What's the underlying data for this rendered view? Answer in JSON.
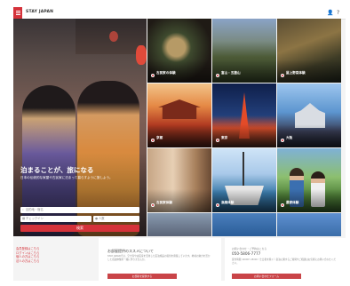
{
  "header": {
    "logo": "STAY JAPAN",
    "person_icon": "person-icon",
    "help_icon": "help-icon",
    "person_glyph": "👤",
    "help_glyph": "?"
  },
  "hero": {
    "title": "泊まることが、旅になる",
    "subtitle": "日本の伝統的な家屋や古民家に泊まって暮らすように旅しよう。",
    "search_where_placeholder": "目的地・宿名",
    "checkin_placeholder": "チェックイン",
    "guests_placeholder": "人数",
    "search_button": "検索"
  },
  "tiles": [
    {
      "name": "古民家の体験",
      "sub": ""
    },
    {
      "name": "富山・五箇山",
      "sub": ""
    },
    {
      "name": "屋上野菜体験",
      "sub": ""
    },
    {
      "name": "京都",
      "sub": ""
    },
    {
      "name": "東京",
      "sub": ""
    },
    {
      "name": "大阪",
      "sub": ""
    },
    {
      "name": "古民家体験",
      "sub": ""
    },
    {
      "name": "漁業体験",
      "sub": ""
    },
    {
      "name": "農家体験",
      "sub": ""
    }
  ],
  "footer": {
    "links": [
      "会員登録はこちら",
      "ログインはこちら",
      "",
      "個人の方はこちら",
      "法人の方はこちら"
    ],
    "panel1": {
      "title": "お部屋提供のススメについて",
      "text": "STAY JAPANでは、空き家や古民家を活用した民泊施設の提供を募集しています。地域の魅力を活かした宿泊体験を一緒に作りませんか。",
      "button": "お部屋を提供する"
    },
    "panel2": {
      "small": "お問い合わせ・ご予約はこちら",
      "number": "050-5806-7777",
      "text": "受付時間 10:00〜18:00（土日祝を除く）宿泊に関するご質問やご相談はお気軽にお問い合わせください。",
      "button": "お問い合わせフォーム"
    }
  },
  "colors": {
    "accent": "#d5323a"
  }
}
